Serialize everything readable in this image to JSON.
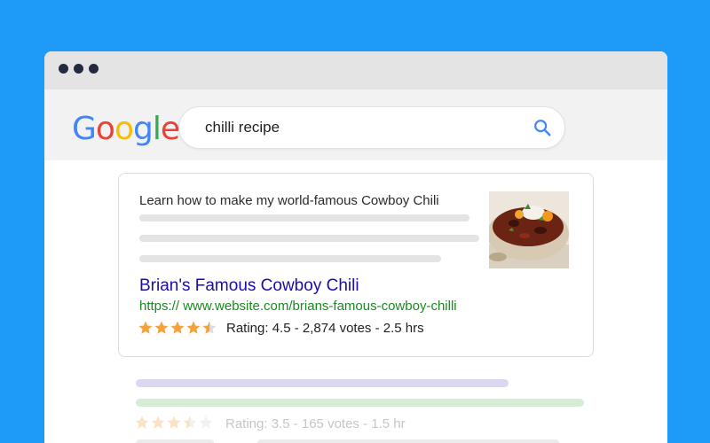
{
  "window": {
    "controls": [
      "close",
      "minimize",
      "maximize"
    ]
  },
  "search": {
    "logo_letters": [
      "G",
      "o",
      "o",
      "g",
      "l",
      "e"
    ],
    "query": "chilli recipe",
    "icon": "search-icon"
  },
  "result": {
    "description": "Learn how to make my world-famous Cowboy Chili",
    "image": "chili-bowl-thumbnail",
    "title": "Brian's Famous Cowboy Chili",
    "url": "https:// www.website.com/brians-famous-cowboy-chilli",
    "rating_stars": 4.5,
    "rating_text": "Rating: 4.5 - 2,874 votes - 2.5 hrs",
    "star_color": "#f6a23a"
  },
  "faded_result": {
    "rating_stars": 3.5,
    "rating_text": "Rating: 3.5 - 165 votes - 1.5 hr"
  },
  "colors": {
    "background": "#1e9bf8",
    "link": "#1a0dab",
    "url": "#1a8a1f"
  }
}
